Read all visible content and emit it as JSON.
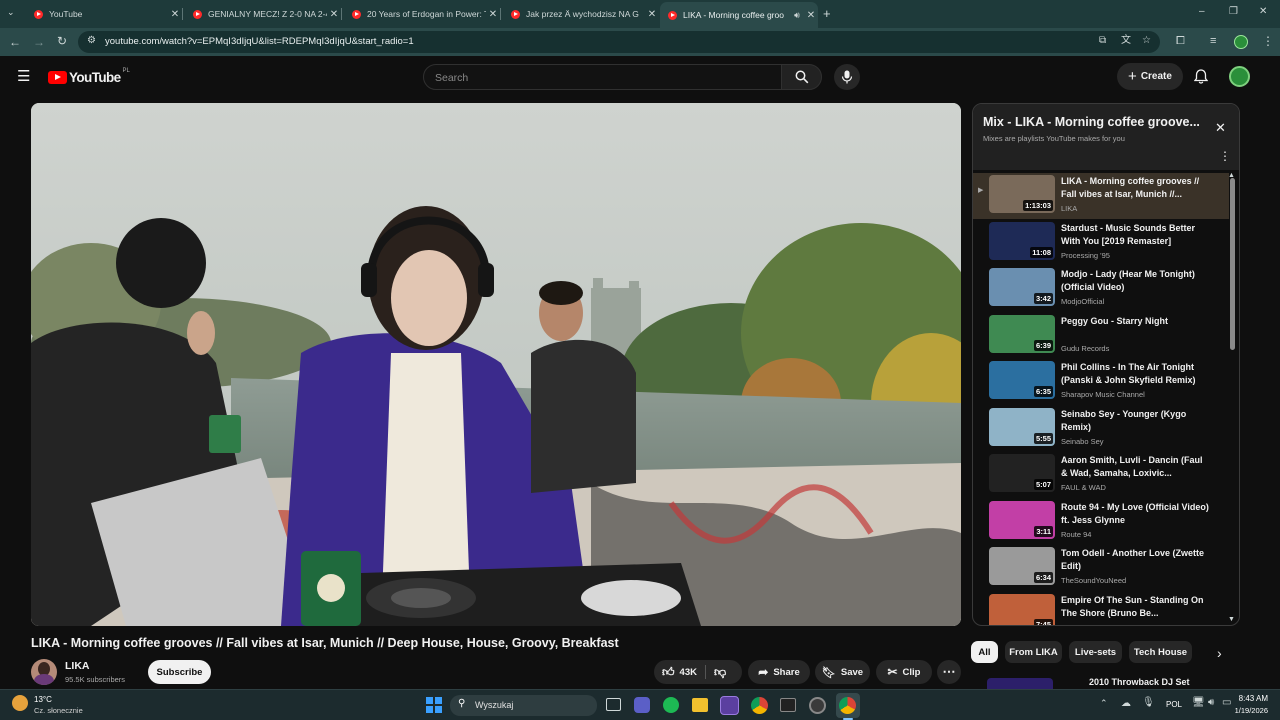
{
  "browser": {
    "tabs": [
      {
        "title": "YouTube"
      },
      {
        "title": "GENIALNY MECZ! Z 2-0 NA 2-4"
      },
      {
        "title": "20 Years of Erdogan in Power: T"
      },
      {
        "title": "Jak przez Ä wychodzisz NA G"
      },
      {
        "title": "LIKA - Morning coffee groo"
      }
    ],
    "url": "youtube.com/watch?v=EPMqI3dIjqU&list=RDEPMqI3dIjqU&start_radio=1"
  },
  "youtube": {
    "logo": "YouTube",
    "region": "PL",
    "search_placeholder": "Search",
    "create_label": "Create"
  },
  "video": {
    "title": "LIKA - Morning coffee grooves // Fall vibes at Isar, Munich // Deep House, House, Groovy, Breakfast",
    "channel": "LIKA",
    "subscribers": "95.5K subscribers",
    "subscribe_label": "Subscribe",
    "likes": "43K",
    "share_label": "Share",
    "save_label": "Save",
    "clip_label": "Clip"
  },
  "playlist": {
    "title": "Mix - LIKA - Morning coffee groove...",
    "subtitle": "Mixes are playlists YouTube makes for you",
    "items": [
      {
        "title": "LIKA - Morning coffee grooves // Fall vibes at Isar, Munich //...",
        "channel": "LIKA",
        "duration": "1:13:03",
        "color": "#7a6a5a"
      },
      {
        "title": "Stardust - Music Sounds Better With You [2019 Remaster]",
        "channel": "Processing '95",
        "duration": "11:08",
        "color": "#1e2a56"
      },
      {
        "title": "Modjo - Lady (Hear Me Tonight) (Official Video)",
        "channel": "ModjoOfficial",
        "duration": "3:42",
        "color": "#6a8fb0"
      },
      {
        "title": "Peggy Gou - Starry Night",
        "channel": "Gudu Records",
        "duration": "6:39",
        "color": "#3f8a52"
      },
      {
        "title": "Phil Collins - In The Air Tonight (Panski & John Skyfield Remix)",
        "channel": "Sharapov Music Channel",
        "duration": "6:35",
        "color": "#2b6fa0"
      },
      {
        "title": "Seinabo Sey - Younger (Kygo Remix)",
        "channel": "Seinabo Sey",
        "duration": "5:55",
        "color": "#8fb3c7"
      },
      {
        "title": "Aaron Smith, Luvli - Dancin (Faul & Wad, Samaha, Loxivic...",
        "channel": "FAUL & WAD",
        "duration": "5:07",
        "color": "#222222"
      },
      {
        "title": "Route 94 - My Love (Official Video) ft. Jess Glynne",
        "channel": "Route 94",
        "duration": "3:11",
        "color": "#c23fa6"
      },
      {
        "title": "Tom Odell - Another Love (Zwette Edit)",
        "channel": "TheSoundYouNeed",
        "duration": "6:34",
        "color": "#9a9a9a"
      },
      {
        "title": "Empire Of The Sun - Standing On The Shore (Bruno Be...",
        "channel": "",
        "duration": "7:45",
        "color": "#c0603a"
      }
    ],
    "chips": [
      "All",
      "From LIKA",
      "Live-sets",
      "Tech House"
    ],
    "next_item": "2010 Throwback DJ Set"
  },
  "taskbar": {
    "temp": "13°C",
    "weather": "Cz. słonecznie",
    "search_label": "Wyszukaj",
    "lang": "POL",
    "time": "8:43 AM",
    "date": "1/19/2026"
  }
}
